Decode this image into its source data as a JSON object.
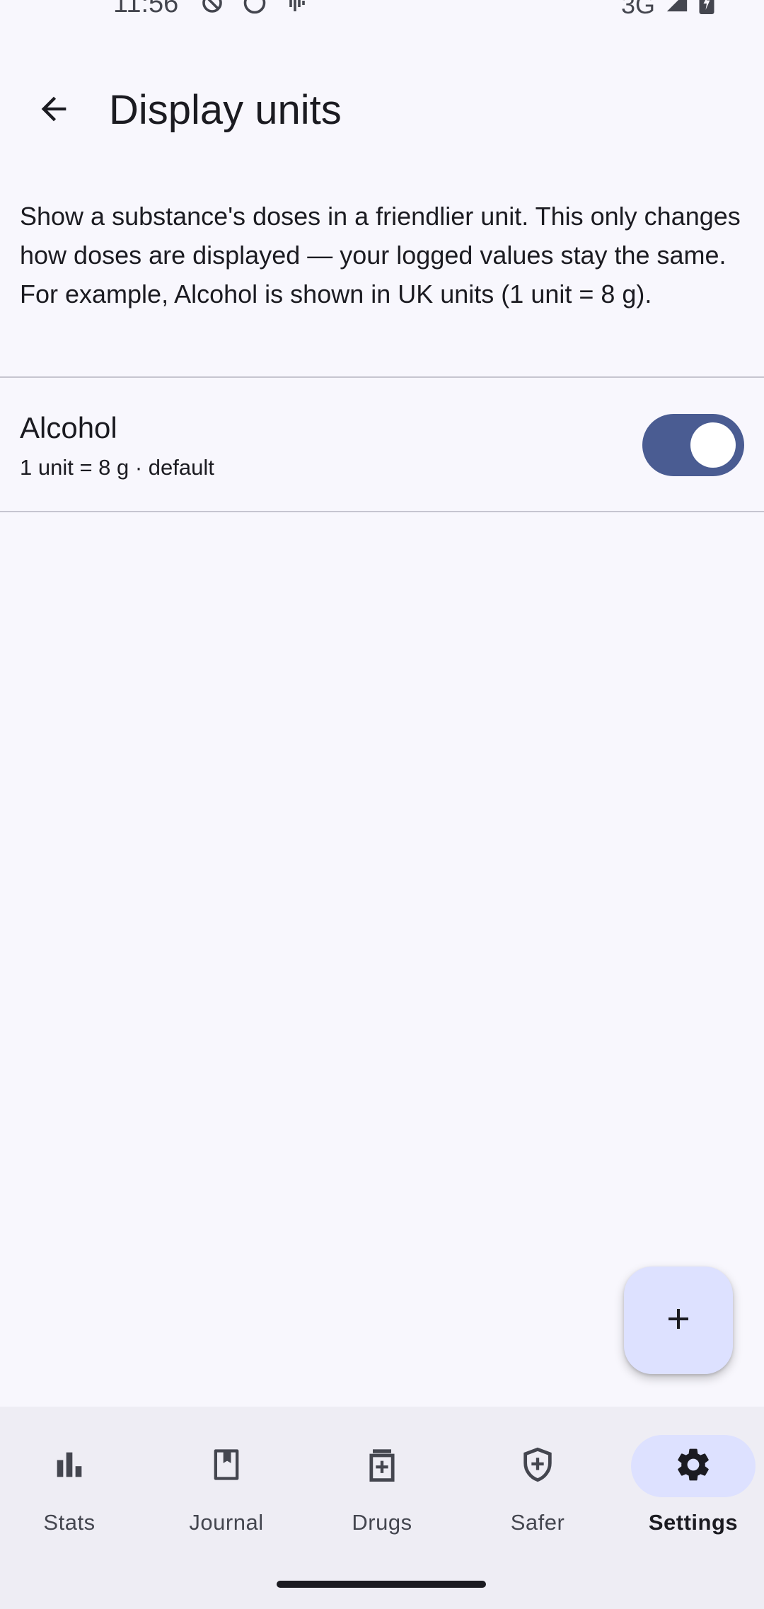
{
  "status_bar": {
    "time": "11:56",
    "network": "3G",
    "icons_left": [
      "data-saver-icon",
      "face-icon",
      "sound-wave-icon"
    ],
    "icons_right": [
      "signal-icon",
      "battery-charging-icon"
    ]
  },
  "top_bar": {
    "title": "Display units",
    "back_icon": "arrow-back-icon"
  },
  "description": "Show a substance's doses in a friendlier unit. This only changes how doses are displayed — your logged values stay the same. For example, Alcohol is shown in UK units (1 unit = 8 g).",
  "units": [
    {
      "name": "Alcohol",
      "subtitle": "1 unit = 8 g  · default",
      "enabled": true
    }
  ],
  "fab": {
    "icon": "add-icon"
  },
  "bottom_nav": {
    "items": [
      {
        "label": "Stats",
        "icon": "bar-chart-icon",
        "active": false
      },
      {
        "label": "Journal",
        "icon": "bookmark-book-icon",
        "active": false
      },
      {
        "label": "Drugs",
        "icon": "medication-icon",
        "active": false
      },
      {
        "label": "Safer",
        "icon": "shield-plus-icon",
        "active": false
      },
      {
        "label": "Settings",
        "icon": "gear-icon",
        "active": true
      }
    ]
  },
  "colors": {
    "background": "#f8f7fd",
    "accent": "#4a5c92",
    "fab_container": "#dde1ff",
    "nav_background": "#eeedf4",
    "text_primary": "#1b1b21",
    "text_secondary": "#44464f"
  }
}
